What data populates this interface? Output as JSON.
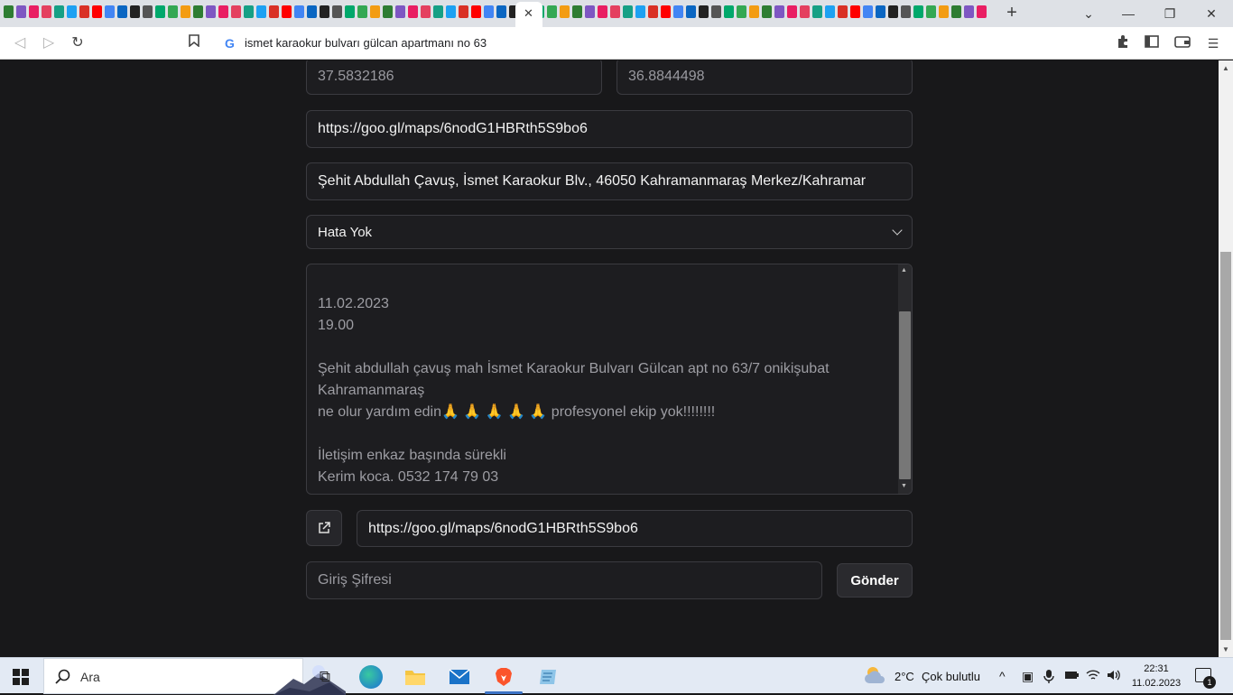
{
  "browser": {
    "address_bar_text": "ismet karaokur bulvarı gülcan apartmanı no 63",
    "tab_close_symbol": "✕",
    "new_tab_symbol": "+"
  },
  "form": {
    "latitude_value": "37.5832186",
    "longitude_value": "36.8844498",
    "maps_link_value": "https://goo.gl/maps/6nodG1HBRth5S9bo6",
    "address_value": "Şehit Abdullah Çavuş, İsmet Karaokur Blv., 46050 Kahramanmaraş Merkez/Kahramar",
    "status_select_value": "Hata Yok",
    "message_lines": [
      "11.02.2023",
      "19.00",
      "",
      "Şehit abdullah çavuş mah İsmet Karaokur Bulvarı Gülcan apt no 63/7 onikişubat",
      "Kahramanmaraş",
      "ne olur yardım edin🙏 🙏 🙏 🙏 🙏  profesyonel ekip yok!!!!!!!!",
      "",
      "İletişim enkaz başında sürekli",
      "Kerim koca. 0532 174 79 03"
    ],
    "open_link_value": "https://goo.gl/maps/6nodG1HBRth5S9bo6",
    "password_placeholder": "Giriş Şifresi",
    "submit_label": "Gönder"
  },
  "taskbar": {
    "search_label": "Ara",
    "weather_temp": "2°C",
    "weather_desc": "Çok bulutlu",
    "clock_time": "22:31",
    "clock_date": "11.02.2023",
    "notification_count": "1"
  },
  "colors": {
    "page_bg": "#18181a",
    "field_bg": "#1d1d20",
    "field_border": "#3b3b40",
    "taskbar_bg": "#e3eaf4",
    "accent": "#3b72c4"
  }
}
